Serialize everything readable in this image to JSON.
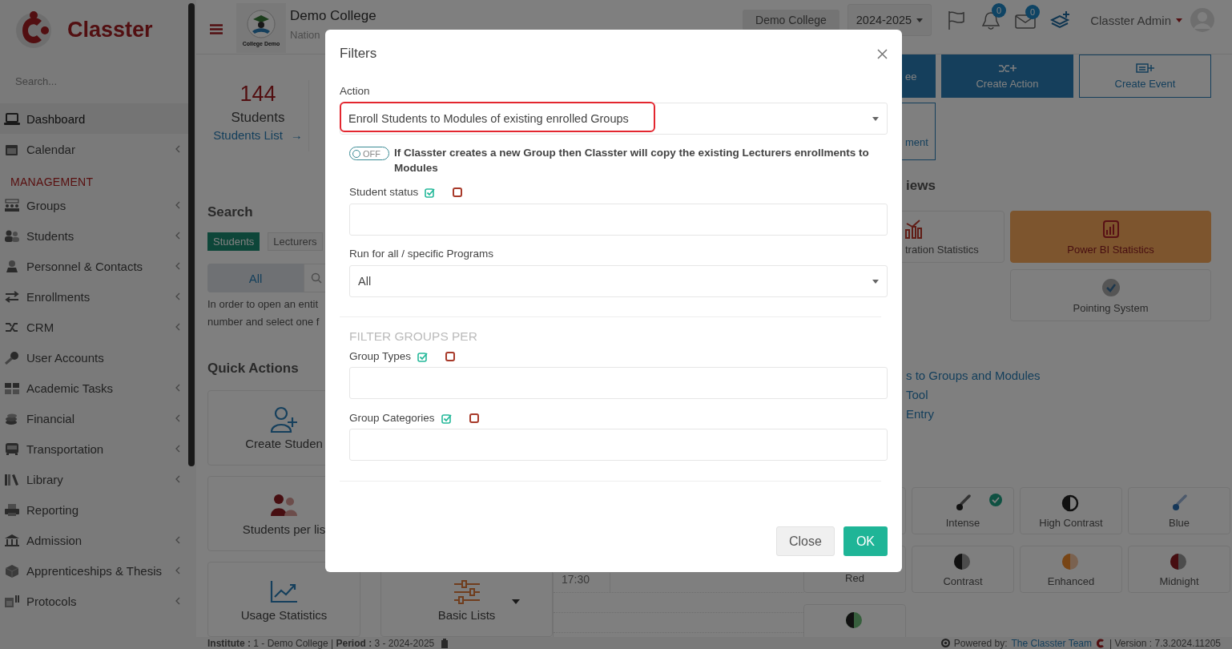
{
  "sidebar": {
    "logo_text": "Classter",
    "search_placeholder": "Search...",
    "items": [
      {
        "kind": "item",
        "label": "Dashboard",
        "selected": true,
        "expandable": false
      },
      {
        "kind": "item",
        "label": "Calendar",
        "selected": false,
        "expandable": true
      },
      {
        "kind": "heading",
        "label": "MANAGEMENT"
      },
      {
        "kind": "item",
        "label": "Groups",
        "selected": false,
        "expandable": true
      },
      {
        "kind": "item",
        "label": "Students",
        "selected": false,
        "expandable": true
      },
      {
        "kind": "item",
        "label": "Personnel & Contacts",
        "selected": false,
        "expandable": true
      },
      {
        "kind": "item",
        "label": "Enrollments",
        "selected": false,
        "expandable": true
      },
      {
        "kind": "item",
        "label": "CRM",
        "selected": false,
        "expandable": true
      },
      {
        "kind": "item",
        "label": "User Accounts",
        "selected": false,
        "expandable": false
      },
      {
        "kind": "item",
        "label": "Academic Tasks",
        "selected": false,
        "expandable": true
      },
      {
        "kind": "item",
        "label": "Financial",
        "selected": false,
        "expandable": true
      },
      {
        "kind": "item",
        "label": "Transportation",
        "selected": false,
        "expandable": true
      },
      {
        "kind": "item",
        "label": "Library",
        "selected": false,
        "expandable": true
      },
      {
        "kind": "item",
        "label": "Reporting",
        "selected": false,
        "expandable": false
      },
      {
        "kind": "item",
        "label": "Admission",
        "selected": false,
        "expandable": true
      },
      {
        "kind": "item",
        "label": "Apprenticeships & Thesis",
        "selected": false,
        "expandable": true
      },
      {
        "kind": "item",
        "label": "Protocols",
        "selected": false,
        "expandable": true
      }
    ]
  },
  "header": {
    "logo_caption": "College Demo",
    "college_name": "Demo College",
    "college_subtitle": "Nation",
    "institute_button": "Demo College",
    "period": "2024-2025",
    "notifications": "0",
    "messages": "0",
    "user": "Classter Admin"
  },
  "stats": [
    {
      "value": "144",
      "label": "Students",
      "link": "Students List",
      "link_arrow": "→"
    }
  ],
  "search": {
    "title": "Search",
    "tabs": [
      {
        "label": "Students",
        "selected": true
      },
      {
        "label": "Lecturers",
        "selected": false
      }
    ],
    "scope": "All",
    "hint_lines": [
      "In order to open an entit",
      "number and select one f"
    ]
  },
  "quick_actions": {
    "title": "Quick Actions",
    "cards": [
      {
        "label": "Create Studen",
        "dropdown": false
      },
      {
        "label": "Students per lis",
        "dropdown": false
      },
      {
        "label": "Usage Statistics",
        "dropdown": false
      },
      {
        "label": "Basic Lists",
        "dropdown": true
      }
    ]
  },
  "calendar": {
    "time": "17:30"
  },
  "actions": [
    {
      "label": "ee",
      "kind": "filled"
    },
    {
      "label": "Create Action",
      "kind": "filled"
    },
    {
      "label": "Create Event",
      "kind": "outline"
    },
    {
      "label": "ment",
      "kind": "outline"
    }
  ],
  "views": {
    "title": "iews",
    "cards": [
      {
        "label": "tration Statistics",
        "highlighted": false
      },
      {
        "label": "Power BI Statistics",
        "highlighted": true
      },
      {
        "label": "Pointing System",
        "highlighted": false
      }
    ]
  },
  "links": [
    "s to Groups and Modules",
    "Tool",
    "Entry"
  ],
  "themes": [
    {
      "label": "Intense",
      "selected": true
    },
    {
      "label": "High Contrast",
      "selected": false
    },
    {
      "label": "Blue",
      "selected": false
    },
    {
      "label": "Red",
      "selected": false
    },
    {
      "label": "Contrast",
      "selected": false
    },
    {
      "label": "Enhanced",
      "selected": false
    },
    {
      "label": "Midnight",
      "selected": false
    },
    {
      "selected": false
    }
  ],
  "modal": {
    "title": "Filters",
    "action": {
      "label": "Action",
      "value": "Enroll Students to Modules of existing enrolled Groups",
      "highlighted": true
    },
    "copy_lecturers": {
      "on": false,
      "state_label": "OFF",
      "text": "If Classter creates a new Group then Classter will copy the existing Lecturers enrollments to Modules"
    },
    "fields": [
      {
        "label": "Student status",
        "kind": "multi"
      },
      {
        "label": "Run for all / specific Programs",
        "kind": "select",
        "value": "All"
      }
    ],
    "section_title": "FILTER GROUPS PER",
    "group_fields": [
      {
        "label": "Group Types",
        "kind": "multi"
      },
      {
        "label": "Group Categories",
        "kind": "multi"
      }
    ],
    "buttons": [
      {
        "label": "Close",
        "kind": "secondary"
      },
      {
        "label": "OK",
        "kind": "primary"
      }
    ]
  },
  "footer": {
    "info": "**Institute :** 1 - Demo College | **Period :** 3 - 2024-2025",
    "powered_label": "Powered by:",
    "powered_link": "The Classter Team",
    "version": "| Version : 7.3.2024.11205"
  }
}
